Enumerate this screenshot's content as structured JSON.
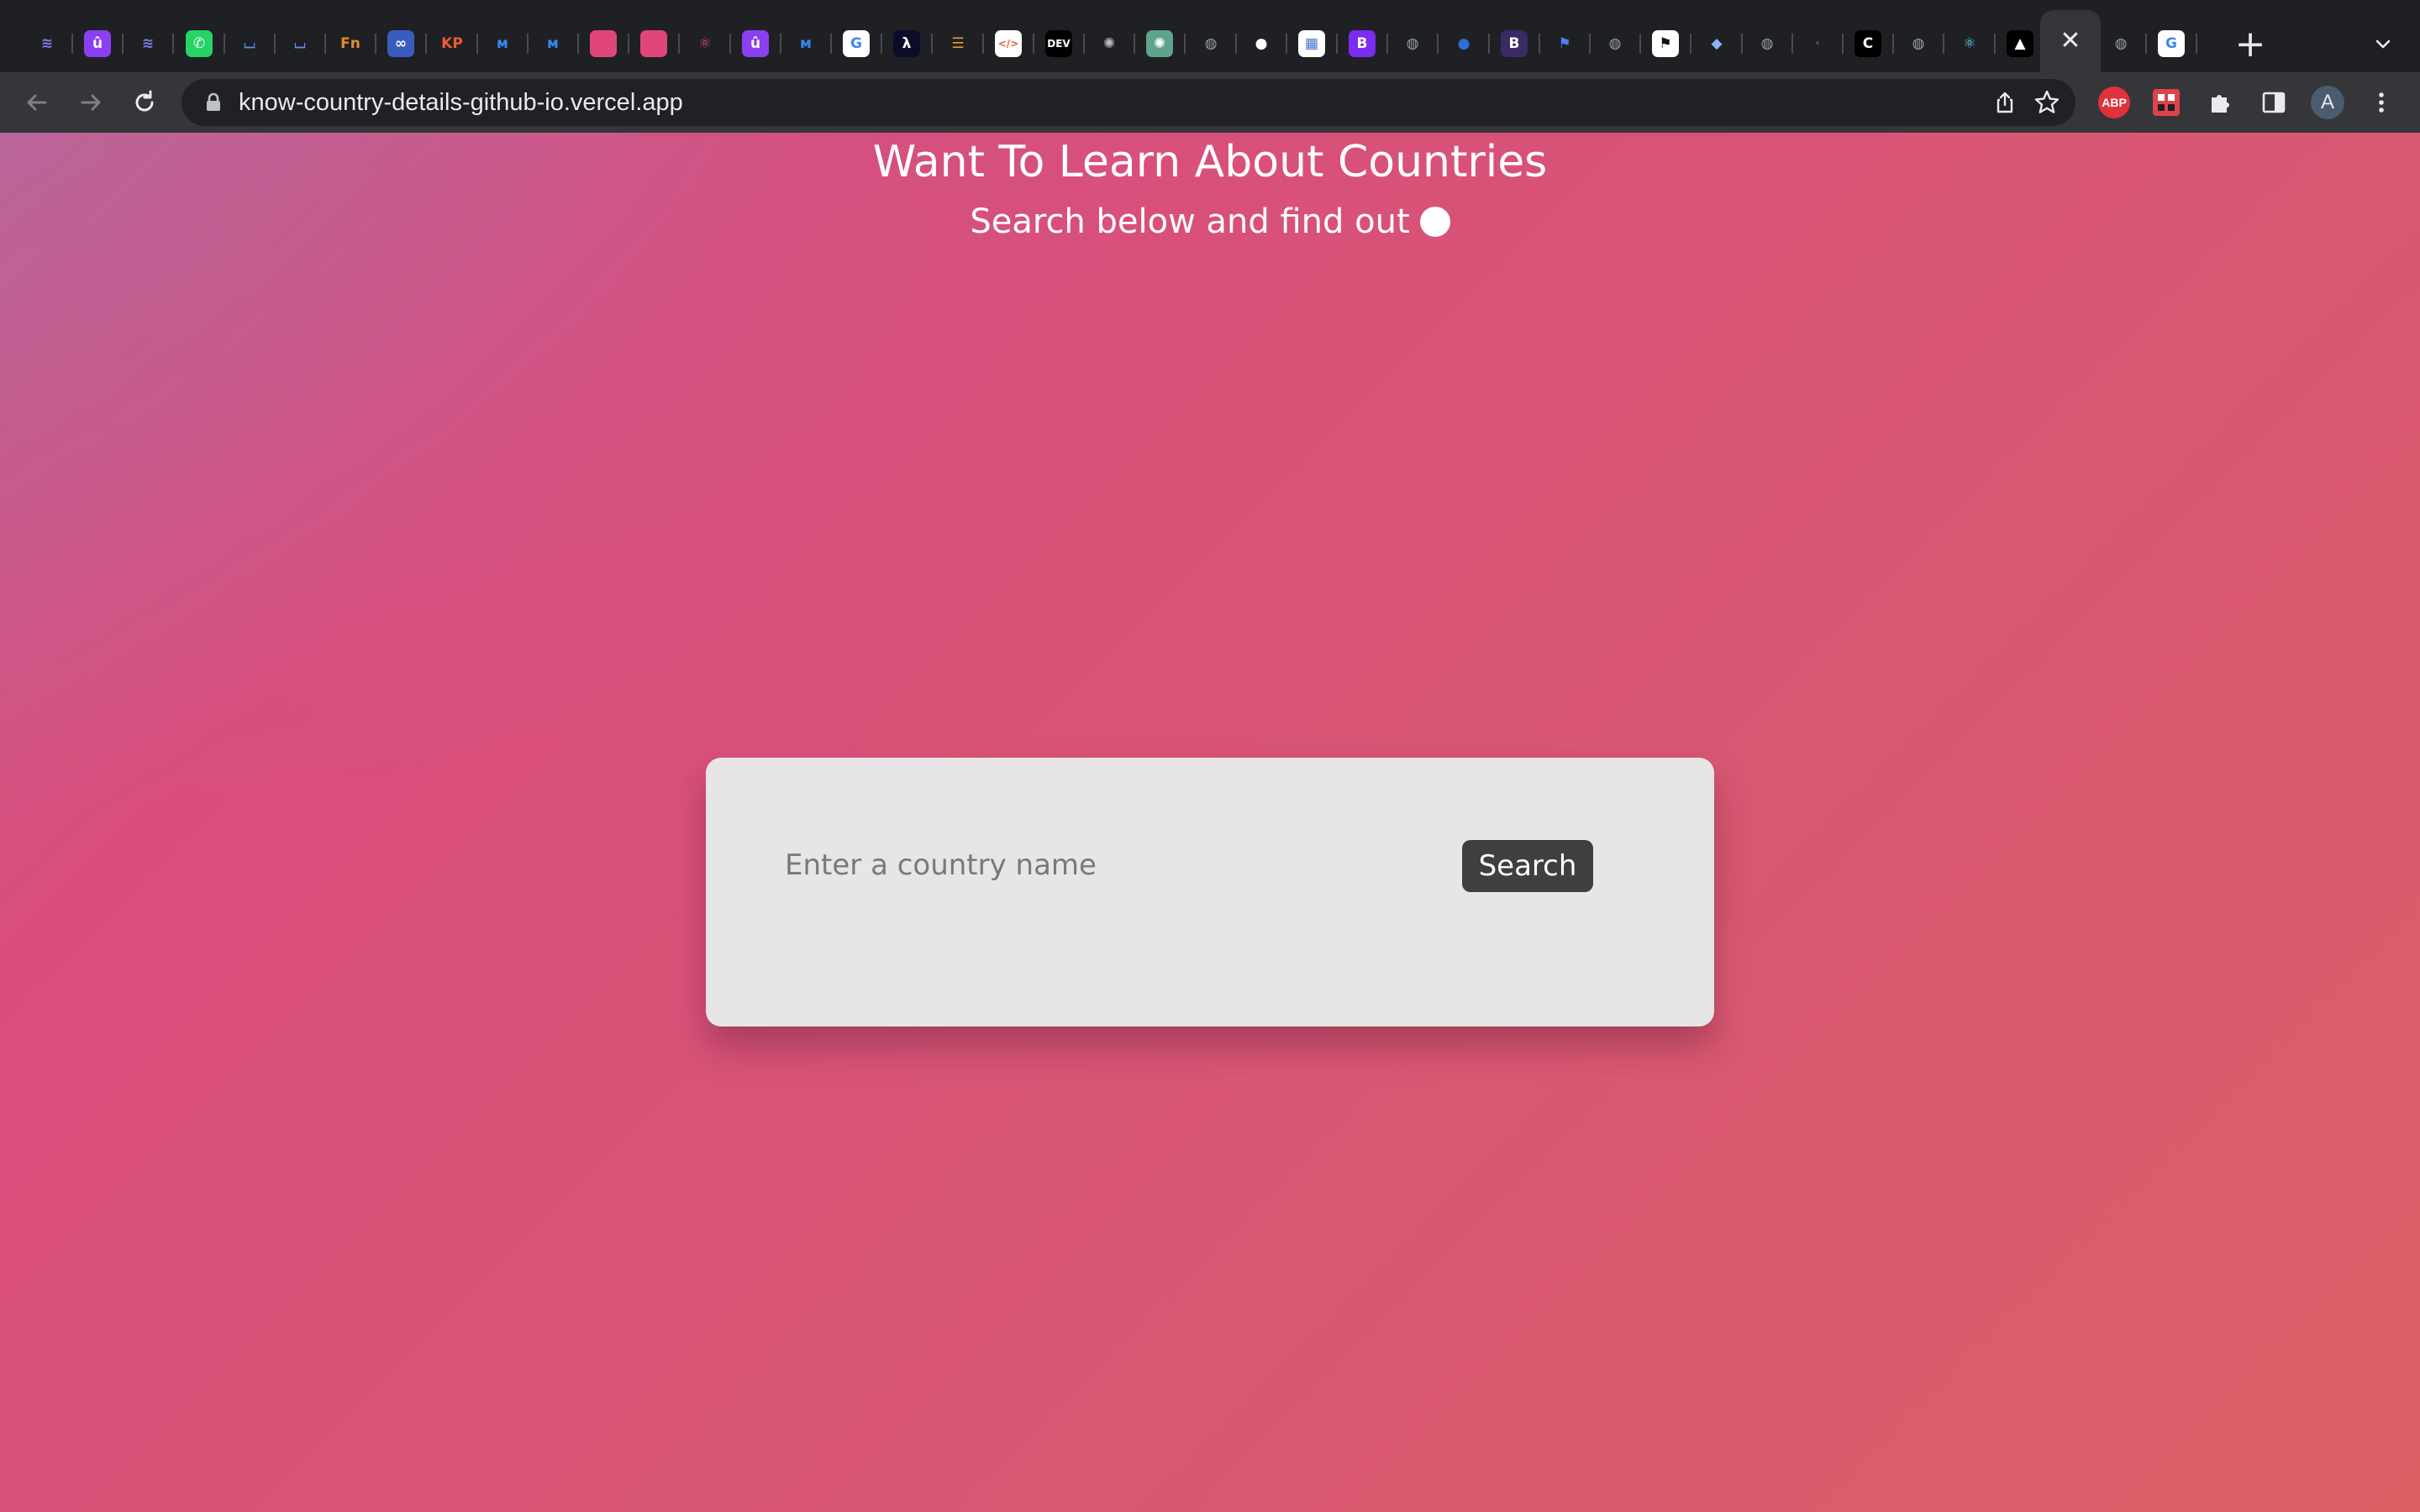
{
  "browser": {
    "tabs": [
      {
        "icon": "stripes-icon",
        "glyph": "≋",
        "bg": "#1f2023",
        "fg": "#7b7fe8"
      },
      {
        "icon": "u-icon",
        "glyph": "û",
        "bg": "#8a3ff0",
        "fg": "#ffffff"
      },
      {
        "icon": "stripes-icon",
        "glyph": "≋",
        "bg": "#1f2023",
        "fg": "#7b7fe8"
      },
      {
        "icon": "whatsapp-icon",
        "glyph": "✆",
        "bg": "#25d366",
        "fg": "#ffffff"
      },
      {
        "icon": "cup-icon",
        "glyph": "⌴",
        "bg": "#1f2023",
        "fg": "#5b8ff2"
      },
      {
        "icon": "cup-icon",
        "glyph": "⌴",
        "bg": "#1f2023",
        "fg": "#5b8ff2"
      },
      {
        "icon": "fn-icon",
        "glyph": "Fn",
        "bg": "#1f2023",
        "fg": "#e48d2b"
      },
      {
        "icon": "infinity-icon",
        "glyph": "∞",
        "bg": "#3a5bbf",
        "fg": "#ffffff"
      },
      {
        "icon": "kp-icon",
        "glyph": "KP",
        "bg": "#1f2023",
        "fg": "#ef5c33"
      },
      {
        "icon": "mui-icon",
        "glyph": "ᴍ",
        "bg": "#1f2023",
        "fg": "#2f8bf2"
      },
      {
        "icon": "mui-icon",
        "glyph": "ᴍ",
        "bg": "#1f2023",
        "fg": "#2f8bf2"
      },
      {
        "icon": "pink-square-icon",
        "glyph": "",
        "bg": "#e1467a",
        "fg": "#ffffff"
      },
      {
        "icon": "pink-square-icon",
        "glyph": "",
        "bg": "#e1467a",
        "fg": "#ffffff"
      },
      {
        "icon": "atom-icon",
        "glyph": "⚛",
        "bg": "#1f2023",
        "fg": "#e84e7a"
      },
      {
        "icon": "u-icon",
        "glyph": "û",
        "bg": "#8a3ff0",
        "fg": "#ffffff"
      },
      {
        "icon": "mui-icon",
        "glyph": "ᴍ",
        "bg": "#1f2023",
        "fg": "#2f8bf2"
      },
      {
        "icon": "google-icon",
        "glyph": "G",
        "bg": "#ffffff",
        "fg": "#4285f4"
      },
      {
        "icon": "lambda-icon",
        "glyph": "λ",
        "bg": "#0b0b2a",
        "fg": "#ffffff"
      },
      {
        "icon": "lines-icon",
        "glyph": "☰",
        "bg": "#1f2023",
        "fg": "#f29a2e"
      },
      {
        "icon": "code-icon",
        "glyph": "</>",
        "bg": "#ffffff",
        "fg": "#e0642b"
      },
      {
        "icon": "dev-icon",
        "glyph": "DEV",
        "bg": "#000000",
        "fg": "#ffffff"
      },
      {
        "icon": "openai-icon",
        "glyph": "✺",
        "bg": "#1f2023",
        "fg": "#b8b8c8"
      },
      {
        "icon": "openai-icon",
        "glyph": "✺",
        "bg": "#5fa38c",
        "fg": "#ffffff"
      },
      {
        "icon": "globe-icon",
        "glyph": "◍",
        "bg": "#1f2023",
        "fg": "#9aa0a6"
      },
      {
        "icon": "github-icon",
        "glyph": "●",
        "bg": "#1f2023",
        "fg": "#ffffff"
      },
      {
        "icon": "image-icon",
        "glyph": "▦",
        "bg": "#ffffff",
        "fg": "#3b78c4"
      },
      {
        "icon": "bootstrap-icon",
        "glyph": "B",
        "bg": "#7c2bef",
        "fg": "#ffffff"
      },
      {
        "icon": "globe-icon",
        "glyph": "◍",
        "bg": "#1f2023",
        "fg": "#9aa0a6"
      },
      {
        "icon": "circle-blue-icon",
        "glyph": "●",
        "bg": "#1f2023",
        "fg": "#2d6fd6"
      },
      {
        "icon": "bootstrap-icon",
        "glyph": "B",
        "bg": "#3a2a66",
        "fg": "#ffffff"
      },
      {
        "icon": "flag-icon",
        "glyph": "⚑",
        "bg": "#1f2023",
        "fg": "#4b83f2"
      },
      {
        "icon": "globe-icon",
        "glyph": "◍",
        "bg": "#1f2023",
        "fg": "#9aa0a6"
      },
      {
        "icon": "flag-icon",
        "glyph": "⚑",
        "bg": "#ffffff",
        "fg": "#111111"
      },
      {
        "icon": "cube-icon",
        "glyph": "◆",
        "bg": "#1f2023",
        "fg": "#8ab4f8"
      },
      {
        "icon": "globe-icon",
        "glyph": "◍",
        "bg": "#1f2023",
        "fg": "#9aa0a6"
      },
      {
        "icon": "blank-icon",
        "glyph": "·",
        "bg": "#1f2023",
        "fg": "#555555"
      },
      {
        "icon": "c-icon",
        "glyph": "C",
        "bg": "#000000",
        "fg": "#ffffff"
      },
      {
        "icon": "globe-icon",
        "glyph": "◍",
        "bg": "#1f2023",
        "fg": "#9aa0a6"
      },
      {
        "icon": "react-icon",
        "glyph": "⚛",
        "bg": "#1f2023",
        "fg": "#61dafb"
      },
      {
        "icon": "vercel-icon",
        "glyph": "▲",
        "bg": "#000000",
        "fg": "#ffffff"
      },
      {
        "icon": "close-icon",
        "glyph": "✕",
        "bg": "#35363a",
        "fg": "#e8eaed",
        "active": true
      },
      {
        "icon": "globe-icon",
        "glyph": "◍",
        "bg": "#1f2023",
        "fg": "#9aa0a6"
      },
      {
        "icon": "google-icon",
        "glyph": "G",
        "bg": "#ffffff",
        "fg": "#4285f4"
      }
    ],
    "new_tab_label": "+",
    "url": "know-country-details-github-io.vercel.app",
    "extensions": {
      "abp_label": "ABP",
      "profile_initial": "A"
    }
  },
  "page": {
    "title": "Want To Learn About Countries",
    "subtitle": "Search below and find out",
    "search": {
      "placeholder": "Enter a country name",
      "value": "",
      "button_label": "Search"
    }
  },
  "colors": {
    "card_bg": "#e7e5e6",
    "button_bg": "#3f3f3f",
    "gradient_start": "#d94d7c",
    "gradient_end": "#dc5f66"
  }
}
